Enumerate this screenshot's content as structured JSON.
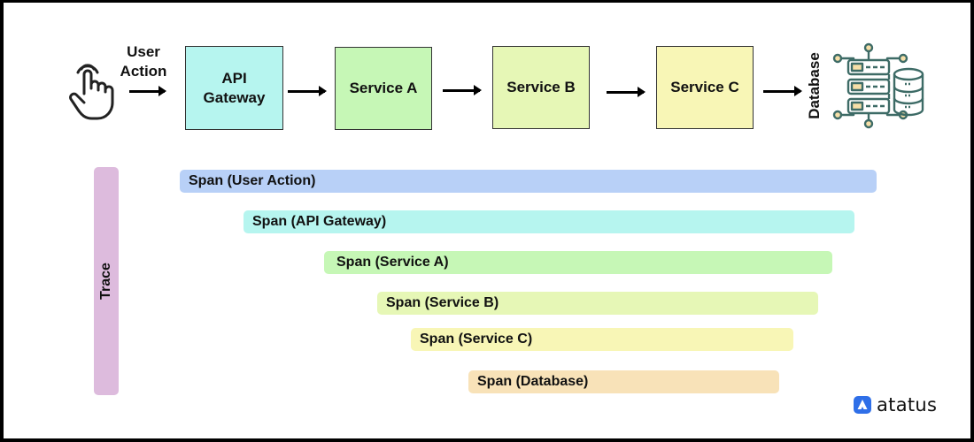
{
  "flow": {
    "user_action_label": "User Action",
    "nodes": [
      {
        "id": "api-gateway",
        "label": "API Gateway",
        "color": "#b6f5ef"
      },
      {
        "id": "service-a",
        "label": "Service A",
        "color": "#c6f7b6"
      },
      {
        "id": "service-b",
        "label": "Service B",
        "color": "#e6f7b6"
      },
      {
        "id": "service-c",
        "label": "Service C",
        "color": "#f8f6b6"
      }
    ],
    "database_label": "Database",
    "icons": {
      "user": "hand-pointer-icon",
      "database": "database-server-icon"
    }
  },
  "trace": {
    "label": "Trace",
    "color": "#ddbbdd",
    "spans": [
      {
        "label": "Span (User Action)",
        "color": "#b8d0f7"
      },
      {
        "label": "Span (API Gateway)",
        "color": "#b6f5ef"
      },
      {
        "label": "Span (Service A)",
        "color": "#c6f7b6"
      },
      {
        "label": "Span (Service B)",
        "color": "#e6f7b6"
      },
      {
        "label": "Span (Service C)",
        "color": "#f8f6b6"
      },
      {
        "label": "Span (Database)",
        "color": "#f8e2b8"
      }
    ]
  },
  "brand": {
    "name": "atatus",
    "color": "#2f6fe8"
  }
}
